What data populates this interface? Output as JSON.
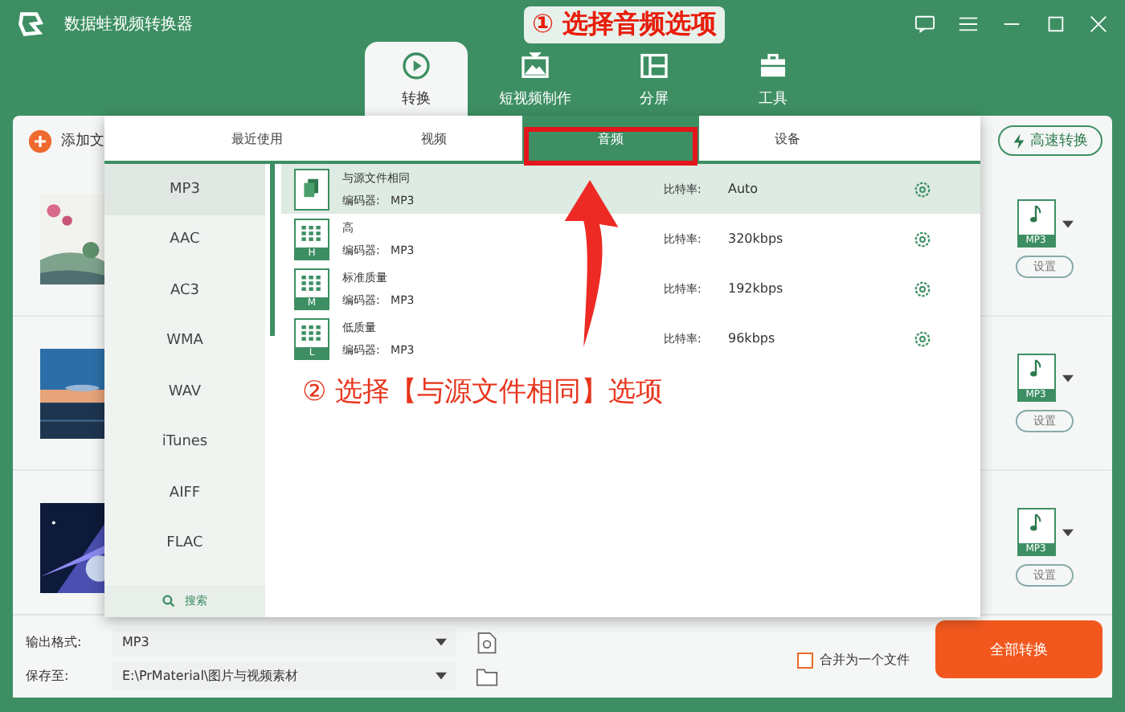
{
  "window": {
    "title": "数据蛙视频转换器"
  },
  "tabs": [
    {
      "label": "转换",
      "selected": true
    },
    {
      "label": "短视频制作",
      "selected": false
    },
    {
      "label": "分屏",
      "selected": false
    },
    {
      "label": "工具",
      "selected": false
    }
  ],
  "toolbar": {
    "add_label": "添加文",
    "fast_button": "高速转换"
  },
  "files": [
    {
      "kind": "picture",
      "format": "MP3",
      "button": "设置"
    },
    {
      "kind": "picture",
      "format": "MP3",
      "button": "设置"
    },
    {
      "kind": "picture",
      "format": "MP3",
      "button": "设置"
    }
  ],
  "popup": {
    "tabs": [
      {
        "label": "最近使用",
        "selected": false
      },
      {
        "label": "视频",
        "selected": false
      },
      {
        "label": "音频",
        "selected": true
      },
      {
        "label": "设备",
        "selected": false
      }
    ],
    "formats": [
      {
        "label": "MP3",
        "selected": true
      },
      {
        "label": "AAC",
        "selected": false
      },
      {
        "label": "AC3",
        "selected": false
      },
      {
        "label": "WMA",
        "selected": false
      },
      {
        "label": "WAV",
        "selected": false
      },
      {
        "label": "iTunes",
        "selected": false
      },
      {
        "label": "AIFF",
        "selected": false
      },
      {
        "label": "FLAC",
        "selected": false
      }
    ],
    "search": "搜索",
    "presets": [
      {
        "name": "与源文件相同",
        "encoder": "编码器:   MP3",
        "bitrate_label": "比特率:",
        "bitrate": "Auto",
        "selected": true
      },
      {
        "name": "高",
        "badge": "H",
        "encoder": "编码器:   MP3",
        "bitrate_label": "比特率:",
        "bitrate": "320kbps",
        "selected": false
      },
      {
        "name": "标准质量",
        "badge": "M",
        "encoder": "编码器:   MP3",
        "bitrate_label": "比特率:",
        "bitrate": "192kbps",
        "selected": false
      },
      {
        "name": "低质量",
        "badge": "L",
        "encoder": "编码器:   MP3",
        "bitrate_label": "比特率:",
        "bitrate": "96kbps",
        "selected": false
      }
    ]
  },
  "annotations": {
    "step1": "① 选择音频选项",
    "step2": "② 选择【与源文件相同】选项"
  },
  "bottom": {
    "format_label": "输出格式:",
    "format_value": "MP3",
    "save_label": "保存至:",
    "save_value": "E:\\PrMaterial\\图片与视频素材",
    "merge_label": "合并为一个文件",
    "merge_checked": false,
    "convert_button": "全部转换"
  }
}
